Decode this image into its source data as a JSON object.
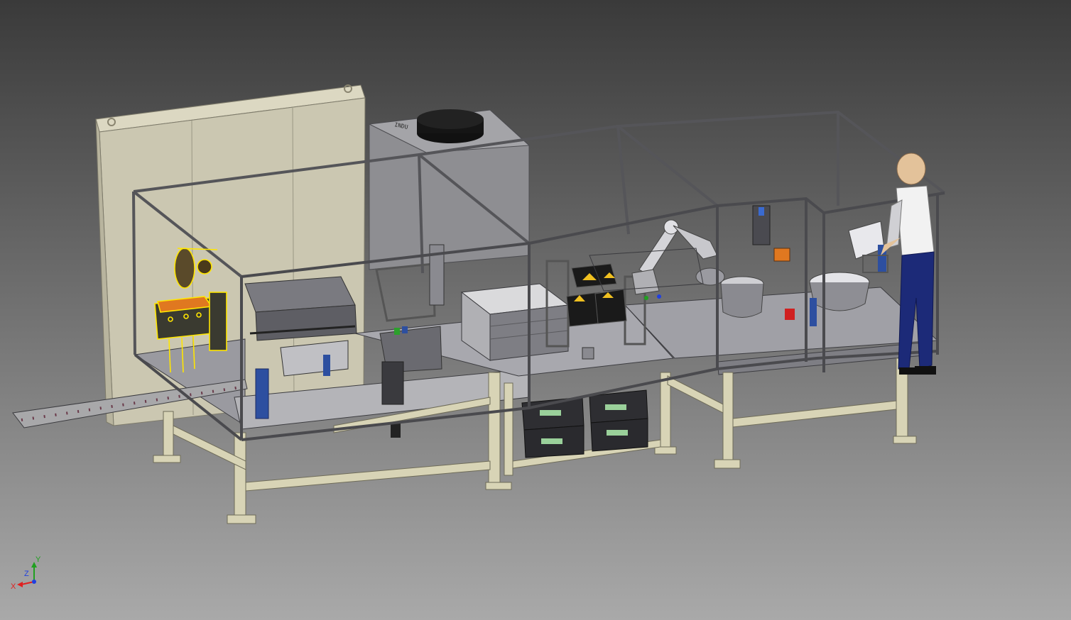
{
  "scene": {
    "description_free": true,
    "panel_text": "INDU",
    "colors": {
      "background_top": "#3a3a3a",
      "background_bottom": "#a9a9a9",
      "frame": "#555559",
      "cabinet": "#cbc7b1",
      "table_legs": "#d8d4b6",
      "selection_highlight": "#ffe600",
      "accent_orange": "#e07820",
      "operator_pants": "#1c2a78"
    }
  },
  "axis_triad": {
    "x_label": "X",
    "y_label": "Y",
    "z_label": "Z",
    "x_color": "#e02020",
    "y_color": "#20a020",
    "z_color": "#2040e0"
  }
}
